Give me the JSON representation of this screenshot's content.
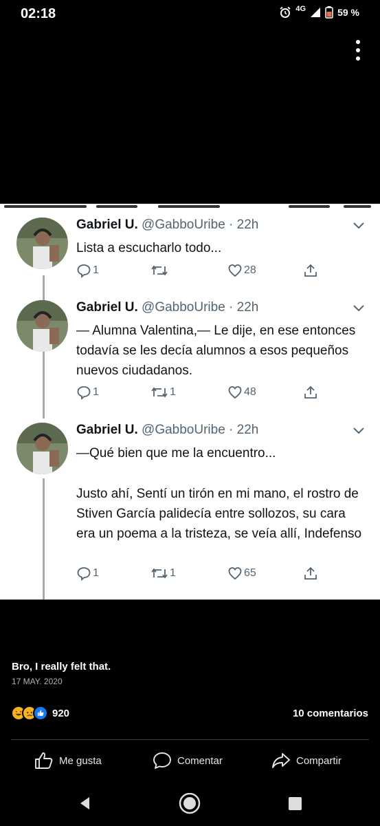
{
  "status_bar": {
    "time": "02:18",
    "network": "4G",
    "battery": "59 %",
    "icons": [
      "alarm-icon",
      "signal-icon",
      "battery-icon"
    ]
  },
  "menu": {
    "icon": "more-vertical-icon"
  },
  "tweets": [
    {
      "name": "Gabriel U.",
      "meta": "@GabboUribe · 22h",
      "text": "Lista a escucharlo todo...",
      "replies": "1",
      "retweets": "",
      "likes": "28"
    },
    {
      "name": "Gabriel U.",
      "meta": "@GabboUribe · 22h",
      "text": "— Alumna Valentina,— Le dije, en ese entonces todavía se les decía alumnos a esos pequeños nuevos ciudadanos.",
      "replies": "1",
      "retweets": "1",
      "likes": "48"
    },
    {
      "name": "Gabriel U.",
      "meta": "@GabboUribe · 22h",
      "text_line1": "—Qué bien que me la encuentro...",
      "text_para2": "Justo ahí, Sentí un tirón en mi mano, el rostro de Stiven García palidecía entre sollozos, su cara era un poema a la tristeza, se veía allí, Indefenso",
      "replies": "1",
      "retweets": "1",
      "likes": "65"
    }
  ],
  "post": {
    "text": "Bro, I really felt that.",
    "date": "17 MAY. 2020",
    "reaction_count": "920",
    "reaction_icons": [
      "haha-icon",
      "sad-icon",
      "like-icon"
    ],
    "comments": "10 comentarios"
  },
  "actions": {
    "like": "Me gusta",
    "comment": "Comentar",
    "share": "Compartir"
  },
  "colors": {
    "background": "#000000",
    "tweet_bg": "#ffffff",
    "tweet_text": "#0f1419",
    "tweet_meta": "#536471",
    "fb_text": "#e4e6eb"
  }
}
